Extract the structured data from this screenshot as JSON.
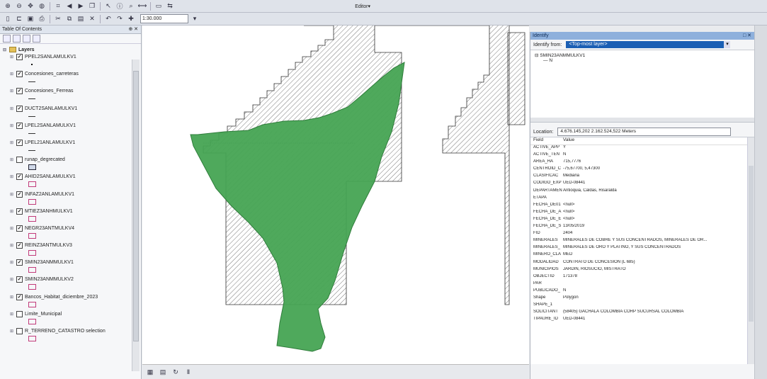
{
  "toolbar1": {
    "icons": [
      "zoom-in-icon",
      "zoom-out-icon",
      "pan-icon",
      "full-extent-icon",
      "fixed-zoom-icon",
      "back-icon",
      "forward-icon",
      "bookmark-icon",
      "select-icon",
      "identify-icon",
      "find-icon",
      "measure-icon",
      "html-popup-icon",
      "swipe-icon"
    ],
    "editor_label": "Editor▾"
  },
  "toolbar2": {
    "icons": [
      "new-icon",
      "open-icon",
      "save-icon",
      "print-icon",
      "cut-icon",
      "copy-icon",
      "paste-icon",
      "delete-icon",
      "undo-icon",
      "redo-icon",
      "add-data-icon"
    ],
    "scale": "1:30.000"
  },
  "toc": {
    "title": "Table Of Contents",
    "root_label": "Layers",
    "layers": [
      {
        "name": "PPEL2SANLAMULKV1",
        "checked": true,
        "symbol": "dot"
      },
      {
        "name": "Concesiones_carreteras",
        "checked": true,
        "symbol": "line"
      },
      {
        "name": "Concesiones_Ferreas",
        "checked": true,
        "symbol": "line"
      },
      {
        "name": "DUCT2SANLAMULKV1",
        "checked": true,
        "symbol": "line"
      },
      {
        "name": "LPEL2SANLAMULKV1",
        "checked": true,
        "symbol": "line"
      },
      {
        "name": "LPEL21ANLAMULKV1",
        "checked": true,
        "symbol": "line"
      },
      {
        "name": "runap_degrecated",
        "checked": false,
        "symbol": "dark"
      },
      {
        "name": "AHID2SANLAMULKV1",
        "checked": true,
        "symbol": "box"
      },
      {
        "name": "INFAZ2ANLAMULKV1",
        "checked": true,
        "symbol": "box"
      },
      {
        "name": "MTIEZ3ANHMULKV1",
        "checked": true,
        "symbol": "box"
      },
      {
        "name": "NEGR23ANTMULKV4",
        "checked": true,
        "symbol": "box"
      },
      {
        "name": "REINZ3ANTMULKV3",
        "checked": true,
        "symbol": "box"
      },
      {
        "name": "SMIN23ANMMULKV1",
        "checked": true,
        "symbol": "box"
      },
      {
        "name": "SMIN23ANMMULKV2",
        "checked": true,
        "symbol": "box"
      },
      {
        "name": "Bancos_Habitat_diciembre_2023",
        "checked": true,
        "symbol": "box"
      },
      {
        "name": "Limite_Municipal",
        "checked": false,
        "symbol": "box"
      },
      {
        "name": "R_TERRENO_CATASTRO selection",
        "checked": false,
        "symbol": "box"
      }
    ]
  },
  "identify": {
    "title": "Identify",
    "from_label": "Identify from:",
    "from_value": "<Top-most layer>",
    "tree_parent": "SMIN23ANMMULKV1",
    "tree_child": "N",
    "location_label": "Location:",
    "location_value": "4.676.145,202  2.162.524,522 Meters",
    "col_field": "Field",
    "col_value": "Value",
    "rows": [
      {
        "field": "ACTIVE_APP",
        "value": "Y"
      },
      {
        "field": "ACTIVE_TEN",
        "value": "N"
      },
      {
        "field": "AREA_HA",
        "value": "715,7776"
      },
      {
        "field": "CENTROID_C",
        "value": "-75,67700, 5,47300"
      },
      {
        "field": "CLASIFICAC",
        "value": "Mediana"
      },
      {
        "field": "CODIGO_EXP",
        "value": "UED-08441"
      },
      {
        "field": "DEPARTAMEN",
        "value": "Antioquia, Caldas, Risaralda"
      },
      {
        "field": "ETAPA",
        "value": ""
      },
      {
        "field": "FECHA_DE01",
        "value": "<null>"
      },
      {
        "field": "FECHA_DE_A",
        "value": "<null>"
      },
      {
        "field": "FECHA_DE_E",
        "value": "<null>"
      },
      {
        "field": "FECHA_DE_S",
        "value": "13/05/2019"
      },
      {
        "field": "FID",
        "value": "2404"
      },
      {
        "field": "MINERALES",
        "value": "MINERALES DE COBRE Y SUS CONCENTRADOS, MINERALES DE OR..."
      },
      {
        "field": "MINERALES_",
        "value": "MINERALES DE ORO Y PLATINO, Y SUS CONCENTRADOS"
      },
      {
        "field": "MINERO_CLA",
        "value": "MED"
      },
      {
        "field": "MODALIDAD",
        "value": "CONTRATO DE CONCESIÓN (L 685)"
      },
      {
        "field": "MUNICIPIOS",
        "value": "JARDÍN, RIOSUCIO, MISTRATÓ"
      },
      {
        "field": "OBJECTID",
        "value": "171378"
      },
      {
        "field": "PAR",
        "value": ""
      },
      {
        "field": "PUBLICADO_",
        "value": "N"
      },
      {
        "field": "Shape",
        "value": "Polygon"
      },
      {
        "field": "SHAPE_1",
        "value": ""
      },
      {
        "field": "SOLICITANT",
        "value": "(58405) GACHALÁ COLOMBIA CORP SUCURSAL COLOMBIA"
      },
      {
        "field": "TIPAURE_ID",
        "value": "UED-08441"
      }
    ]
  },
  "colors": {
    "polygon": "#46a453",
    "polygon_stroke": "#2f7d3b",
    "hatch": "#555555",
    "selection": "#1b5fb4"
  }
}
